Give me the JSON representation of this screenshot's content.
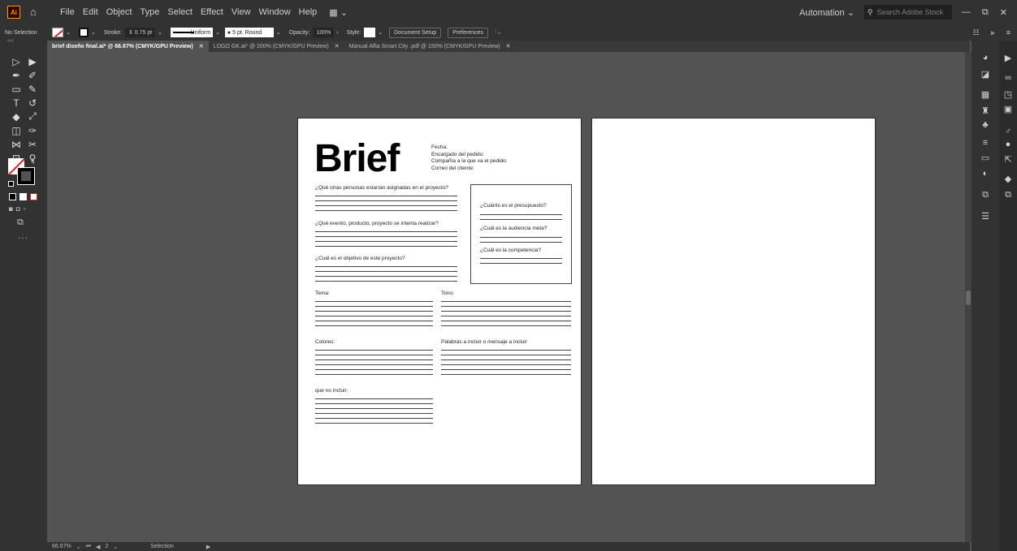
{
  "app": {
    "logo": "Ai",
    "menus": [
      "File",
      "Edit",
      "Object",
      "Type",
      "Select",
      "Effect",
      "View",
      "Window",
      "Help"
    ],
    "workspace": "Automation",
    "search_placeholder": "Search Adobe Stock",
    "window_controls": [
      "—",
      "⧉",
      "✕"
    ]
  },
  "control_bar": {
    "selection": "No Selection",
    "stroke_label": "Stroke:",
    "stroke_weight": "0.75 pt",
    "stroke_profile": "Uniform",
    "brush": "5 pt. Round",
    "opacity_label": "Opacity:",
    "opacity_value": "100%",
    "style_label": "Style:",
    "document_setup": "Document Setup",
    "preferences": "Preferences"
  },
  "tabs": [
    {
      "label": "brief diseño final.ai* @ 66.67% (CMYK/GPU Preview)",
      "active": true
    },
    {
      "label": "LOGO GK.ai* @ 200% (CMYK/GPU Preview)",
      "active": false
    },
    {
      "label": "Manual Alfia Smart City .pdf @ 150% (CMYK/GPU Preview)",
      "active": false
    }
  ],
  "document": {
    "title": "Brief",
    "info": [
      "Fecha:",
      "Encargado del pedido:",
      "Compañía a la que va el pedido:",
      "Correo del cliente:"
    ],
    "questions_left": [
      "¿Qué otras personas estarían asignadas en el proyecto?",
      "¿Qué evento, producto, proyecto se intenta realizar?",
      "¿Cuál es el objetivo de este proyecto?"
    ],
    "questions_box": [
      "¿Cuánto es el presupuesto?",
      "¿Cuál es la audiencia meta?",
      "¿Cuál es la competencia?"
    ],
    "tema": "Tema:",
    "tono": "Tono:",
    "colores": "Colores:",
    "palabras": "Palabras a incluir o mensaje a incluir",
    "no_incluir": "que no incluir:"
  },
  "status_bar": {
    "zoom": "66.67%",
    "artboard": "2",
    "tool": "Selection"
  }
}
